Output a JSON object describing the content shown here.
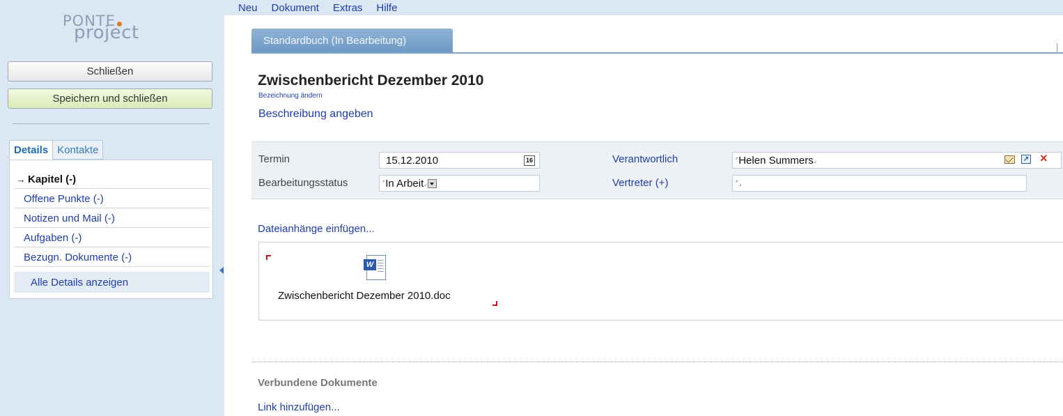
{
  "logo": {
    "line1": "PONTE",
    "line2": "project"
  },
  "sidebar": {
    "close_label": "Schließen",
    "save_close_label": "Speichern und schließen",
    "tabs": [
      {
        "label": "Details"
      },
      {
        "label": "Kontakte"
      }
    ],
    "items": [
      {
        "label": "Kapitel (-)"
      },
      {
        "label": "Offene Punkte (-)"
      },
      {
        "label": "Notizen und Mail (-)"
      },
      {
        "label": "Aufgaben (-)"
      },
      {
        "label": "Bezugn. Dokumente (-)"
      }
    ],
    "all_details_label": "Alle Details anzeigen"
  },
  "menu": {
    "items": [
      "Neu",
      "Dokument",
      "Extras",
      "Hilfe"
    ]
  },
  "main": {
    "tab_label": "Standardbuch  (In Bearbeitung)",
    "title": "Zwischenbericht Dezember 2010",
    "rename_link": "Bezeichnung ändern",
    "description_link": "Beschreibung angeben",
    "props": {
      "termin_label": "Termin",
      "termin_value": "15.12.2010",
      "calendar_day": "16",
      "status_label": "Bearbeitungsstatus",
      "status_value": "In Arbeit",
      "responsible_label": "Verantwortlich",
      "responsible_value": "Helen Summers",
      "deputy_label": "Vertreter (+)",
      "deputy_value": ""
    },
    "attach_link": "Dateianhänge einfügen...",
    "attachment": {
      "file_name": "Zwischenbericht Dezember 2010.doc",
      "icon": "word-document-icon"
    },
    "linked_docs_title": "Verbundene Dokumente",
    "add_link": "Link hinzufügen..."
  },
  "colors": {
    "sidebar_bg": "#dbe7f3",
    "link": "#1f3da8",
    "tab_active": "#7ea6cf",
    "delete": "#d23020",
    "save_button": "#dbebb8"
  }
}
